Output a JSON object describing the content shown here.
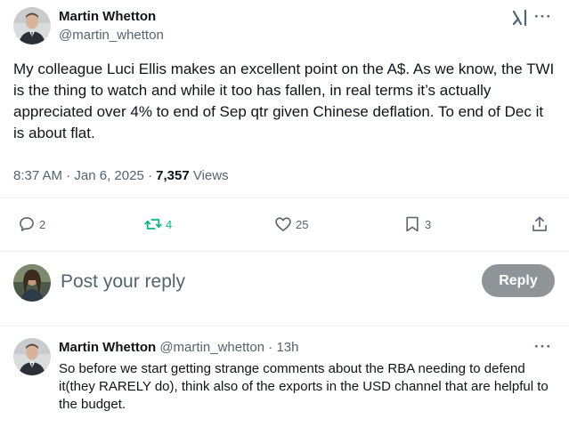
{
  "post": {
    "author_name": "Martin Whetton",
    "author_handle": "@martin_whetton",
    "text": "My colleague Luci Ellis makes an excellent point on the A$. As we know, the TWI is the thing to watch and while it too has fallen, in real terms it’s actually appreciated over 4% to end of Sep qtr given Chinese deflation. To end of Dec it is about flat.",
    "time": "8:37 AM",
    "sep": "·",
    "date": "Jan 6, 2025",
    "views_count": "7,357",
    "views_label": "Views",
    "more_label": "···"
  },
  "actions": {
    "replies": "2",
    "reposts": "4",
    "likes": "25",
    "bookmarks": "3"
  },
  "reply_box": {
    "placeholder": "Post your reply",
    "button_label": "Reply"
  },
  "reply": {
    "author_name": "Martin Whetton",
    "author_handle": "@martin_whetton",
    "sep": "·",
    "time": "13h",
    "text": "So before we start getting strange comments about the RBA needing to defend it(they RARELY do), think also of the exports in the USD channel that are helpful to the budget.",
    "more_label": "···"
  },
  "icons": {
    "grok": "grok-icon",
    "more": "more-icon",
    "reply": "reply-icon",
    "repost": "repost-icon",
    "like": "heart-icon",
    "bookmark": "bookmark-icon",
    "share": "share-icon"
  },
  "colors": {
    "text": "#0f1419",
    "muted": "#536471",
    "repost_green": "#00ba7c",
    "reply_button": "#8e9498",
    "divider": "#eff3f4"
  }
}
